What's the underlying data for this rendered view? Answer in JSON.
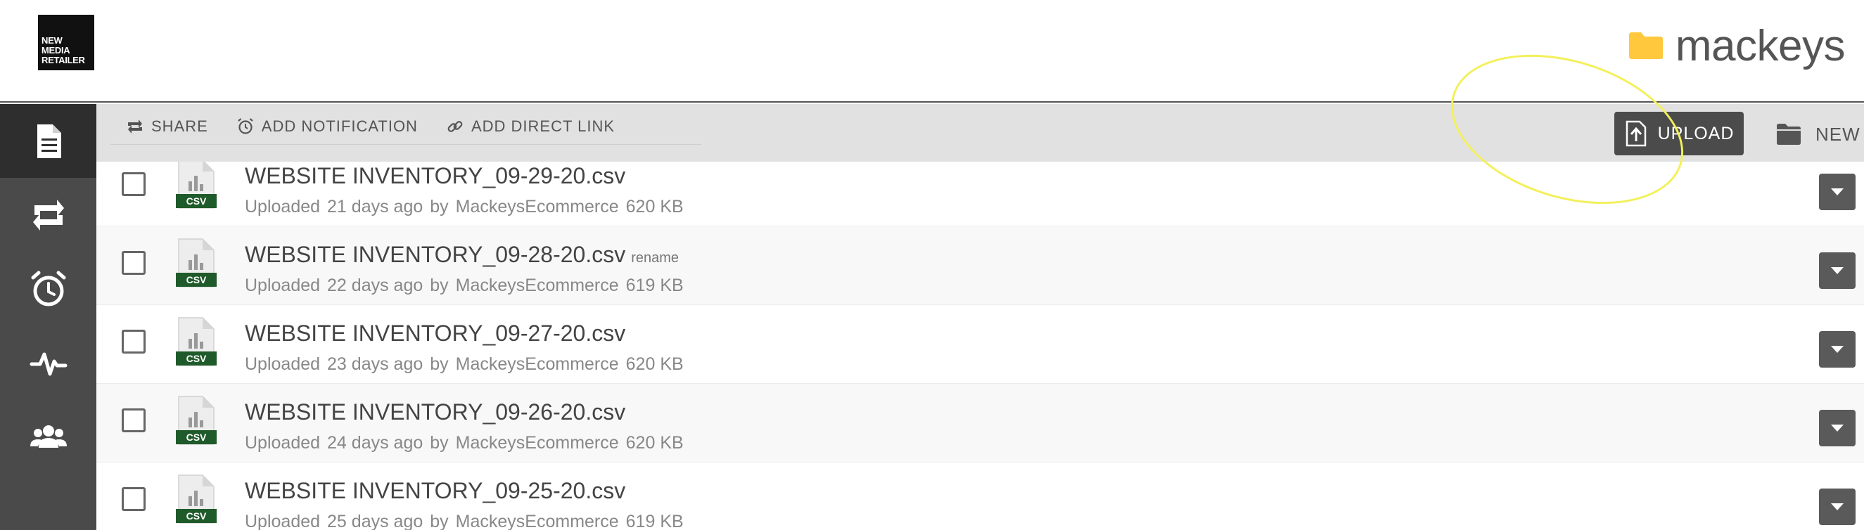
{
  "brand": {
    "logo_lines": [
      "NEW",
      "MEDIA",
      "RETAILER"
    ]
  },
  "folder": {
    "name": "mackeys",
    "icon": "folder-icon",
    "icon_color": "#FFC83D"
  },
  "sidebar": {
    "items": [
      {
        "icon": "document-icon",
        "active": true
      },
      {
        "icon": "share-icon",
        "active": false
      },
      {
        "icon": "alarm-clock-icon",
        "active": false
      },
      {
        "icon": "activity-icon",
        "active": false
      },
      {
        "icon": "users-icon",
        "active": false
      }
    ]
  },
  "toolbar": {
    "share_label": "SHARE",
    "notification_label": "ADD NOTIFICATION",
    "direct_link_label": "ADD DIRECT LINK",
    "upload_label": "UPLOAD",
    "new_folder_label": "NEW FOLDER"
  },
  "files": [
    {
      "name": "WEBSITE INVENTORY_09-29-20.csv",
      "uploaded": "Uploaded",
      "age": "21 days ago",
      "by": "by",
      "user": "MackeysEcommerce",
      "size": "620 KB",
      "rename": ""
    },
    {
      "name": "WEBSITE INVENTORY_09-28-20.csv",
      "uploaded": "Uploaded",
      "age": "22 days ago",
      "by": "by",
      "user": "MackeysEcommerce",
      "size": "619 KB",
      "rename": "rename"
    },
    {
      "name": "WEBSITE INVENTORY_09-27-20.csv",
      "uploaded": "Uploaded",
      "age": "23 days ago",
      "by": "by",
      "user": "MackeysEcommerce",
      "size": "620 KB",
      "rename": ""
    },
    {
      "name": "WEBSITE INVENTORY_09-26-20.csv",
      "uploaded": "Uploaded",
      "age": "24 days ago",
      "by": "by",
      "user": "MackeysEcommerce",
      "size": "620 KB",
      "rename": ""
    },
    {
      "name": "WEBSITE INVENTORY_09-25-20.csv",
      "uploaded": "Uploaded",
      "age": "25 days ago",
      "by": "by",
      "user": "MackeysEcommerce",
      "size": "619 KB",
      "rename": ""
    }
  ],
  "file_badge": "CSV",
  "colors": {
    "sidebar": "#4a4a4a",
    "sidebar_active": "#2e2e2e",
    "toolbar": "#e1e1e1",
    "upload_button": "#4b4b4b",
    "csv_badge": "#1f5b2a",
    "highlight": "#f3f05a"
  }
}
